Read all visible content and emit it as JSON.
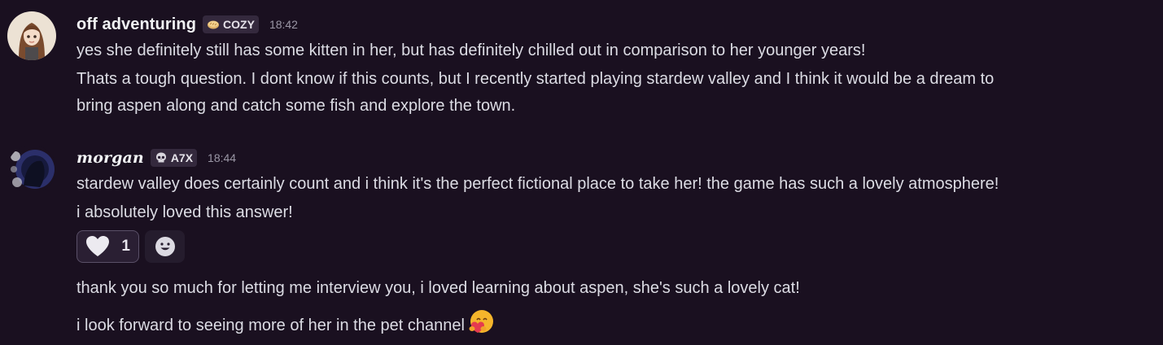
{
  "messages": [
    {
      "username": "off adventuring",
      "tag": "COZY",
      "tag_icon": "bread-icon",
      "time": "18:42",
      "lines": [
        "yes she definitely still has some kitten in her, but has definitely chilled out in comparison to her younger years!",
        "Thats a tough question. I dont know if this counts, but I recently started playing stardew valley and I think it would be a dream to",
        "bring aspen along and catch some fish and explore the town."
      ]
    },
    {
      "username": "morgan",
      "tag": "A7X",
      "tag_icon": "skull-icon",
      "time": "18:44",
      "lines": [
        "stardew valley does certainly count and i think it's the perfect fictional place to take her! the game has such a lovely atmosphere!",
        "i absolutely loved this answer!"
      ],
      "reactions": [
        {
          "emoji": "heart-icon",
          "count": "1"
        }
      ],
      "add_reaction_icon": "smiley-add-reaction-icon"
    },
    {
      "lines": [
        "thank you so much for letting me interview you, i loved learning about aspen, she's such a lovely cat!"
      ]
    },
    {
      "lines": [
        "i look forward to seeing more of her in the pet channel"
      ],
      "trailing_emoji": "heart-hug-emoji-icon"
    }
  ],
  "colors": {
    "background": "#1a1020",
    "username": "#f2f3f5",
    "text": "#dcdce4",
    "timestamp": "#9a96a5",
    "tag_background": "#34293d"
  }
}
